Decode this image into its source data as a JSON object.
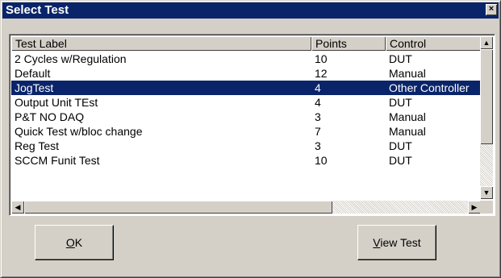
{
  "window": {
    "title": "Select Test",
    "close_glyph": "×"
  },
  "table": {
    "columns": [
      "Test Label",
      "Points",
      "Control"
    ],
    "rows": [
      {
        "label": "2 Cycles w/Regulation",
        "points": "10",
        "control": "DUT"
      },
      {
        "label": "Default",
        "points": "12",
        "control": "Manual"
      },
      {
        "label": "JogTest",
        "points": "4",
        "control": "Other Controller"
      },
      {
        "label": "Output Unit TEst",
        "points": "4",
        "control": "DUT"
      },
      {
        "label": "P&T NO DAQ",
        "points": "3",
        "control": "Manual"
      },
      {
        "label": "Quick Test w/bloc change",
        "points": "7",
        "control": "Manual"
      },
      {
        "label": "Reg Test",
        "points": "3",
        "control": "DUT"
      },
      {
        "label": "SCCM Funit Test",
        "points": "10",
        "control": "DUT"
      }
    ],
    "selected_row": "JogTest"
  },
  "buttons": {
    "ok": {
      "mnemonic": "O",
      "rest": "K"
    },
    "view": {
      "mnemonic": "V",
      "rest": "iew Test"
    }
  },
  "icons": {
    "close": "close-icon",
    "scroll_up": "arrow-up-icon",
    "scroll_down": "arrow-down-icon",
    "scroll_left": "arrow-left-icon",
    "scroll_right": "arrow-right-icon"
  },
  "colors": {
    "title_bar": "#0a246a",
    "selection": "#0a246a",
    "face": "#d4d0c8"
  }
}
